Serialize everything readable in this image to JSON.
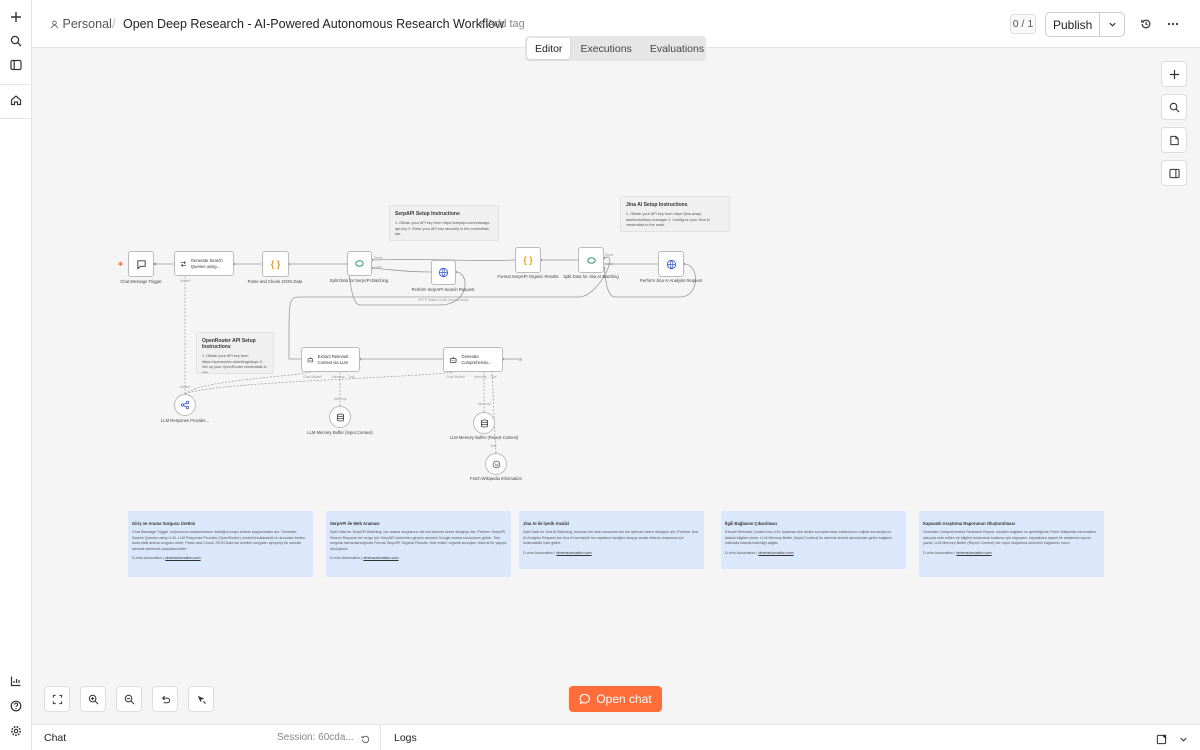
{
  "header": {
    "workspace": "Personal",
    "title": "Open Deep Research - AI-Powered Autonomous Research Workflow",
    "add_tag": "+ Add tag",
    "counter": "0 / 1",
    "publish_label": "Publish"
  },
  "tabs": [
    {
      "label": "Editor",
      "active": true
    },
    {
      "label": "Executions",
      "active": false
    },
    {
      "label": "Evaluations",
      "active": false
    }
  ],
  "nodes": {
    "chat_trigger": "Chat Message Trigger",
    "generate_queries": "Generate Search Queries using...",
    "parse_chunk": "Parse and Chunk JSON Data",
    "split_serpapi": "Split Data for SerpAPI Batching",
    "perform_serpapi": "Perform SerpAPI Search Request",
    "format_serpapi": "Format SerpAPI Organic Results",
    "split_jina": "Split Data for Jina AI Batching",
    "perform_jina": "Perform Jina AI Analysis Request",
    "extract_context": "Extract Relevant Context via LLM",
    "generate_report": "Generate Comprehensiv...",
    "llm_provider": "LLM Response Provider...",
    "memory_input": "LLM Memory Buffer (Input Context)",
    "memory_report": "LLM Memory Buffer (Report Context)",
    "fetch_wiki": "Fetch Wikipedia Information"
  },
  "port_labels": {
    "model": "Model*",
    "chat_model": "Chat Model*",
    "memory": "Memory",
    "tool": "Tool",
    "done": "Done",
    "loop": "Loop",
    "tool_output": "HTTP Status Code (empty body)"
  },
  "notes": {
    "serpapi": {
      "title": "SerpAPI Setup Instructions",
      "body": "1. Obtain your API key from https://serpapi.com/manage-api-key  2. Enter your API key securely in the credentials tab."
    },
    "jina": {
      "title": "Jina AI Setup Instructions",
      "body": "1. Obtain your API key from https://jina.ai/api-dashboard/key-manager  2. Configure your Jina AI credentials in the node."
    },
    "openrouter": {
      "title": "OpenRouter API Setup Instructions",
      "body": "1. Obtain your API key from https://openrouter.ai/settings/keys  2. Set up your OpenRouter credentials in n8n."
    }
  },
  "cards": [
    {
      "title": "Giriş ve Arama Sorgusu Üretimi",
      "body": "Chat Message Trigger, kullanıcının araştırılmasını istediği konuyu sohbet arayüzünden alır. Generate Search Queries using LLM, LLM Response Provider (OpenRouter) modelini kullanarak bu konudan birden fazla etkili arama sorgusu üretir; Parse and Chunk JSON Data ise üretilen sorguları ayrıştırıp bir sonraki adımda işlenecek parçalara böler.",
      "footer": "D-mim Automation |",
      "link": "dmimautomation.com"
    },
    {
      "title": "SerpAPI ile Web Araması",
      "body": "Split Data for SerpAPI Batching, her arama sorgusunu tek tek işlemek üzere döngüye alır. Perform SerpAPI Search Request her sorgu için SerpAPI üzerinden gerçek zamanlı Google arama sonuçlarını getirir. Tüm sorgular tamamlandığında Format SerpAPI Organic Results, elde edilen organik sonuçları düzenli bir yapıya dönüştürür.",
      "footer": "D-mim Automation |",
      "link": "dmimautomation.com"
    },
    {
      "title": "Jina AI ile İçerik Analizi",
      "body": "Split Data for Jina AI Batching, bulunan her web sonucunu tek tek işlemek üzere döngüye alır; Perform Jina AI Analysis Request ise Jina AI servisiyle her sayfanın içeriğini okuyup analiz ederek araştırma için kullanılabilir hale getirir.",
      "footer": "D-mim Automation |",
      "link": "dmimautomation.com"
    },
    {
      "title": "İlgili Bağlamın Çıkarılması",
      "body": "Extract Relevant Context via LLM, toplanan tüm analiz sonuçlarından kullanıcının orijinal sorusuyla en alakalı bilgileri süzer; LLM Memory Buffer (Input Context) bu adımda önceki adımlardan gelen bağlamı hafızada tutarak tutarlılığı sağlar.",
      "footer": "D-mim Automation |",
      "link": "dmimautomation.com"
    },
    {
      "title": "Kapsamlı Araştırma Raporunun Oluşturulması",
      "body": "Generate Comprehensive Research Report, süzülen bağlamı ve gerektiğinde Fetch Wikipedia Information aracıyla elde edilen ek bilgileri kullanarak kullanıcı için kapsamlı, kaynaklara dayalı bir araştırma raporu yazar; LLM Memory Buffer (Report Context) ise rapor oluşturma sürecinin bağlamını korur.",
      "footer": "D-mim Automation |",
      "link": "dmimautomation.com"
    }
  ],
  "open_chat_label": "Open chat",
  "bottom": {
    "chat_label": "Chat",
    "session": "Session: 60cda...",
    "logs_label": "Logs"
  },
  "colors": {
    "accent": "#ff6d3a",
    "card_bg": "#dbe8fb",
    "canvas_bg": "#f5f5f5",
    "connection": "#999999"
  }
}
